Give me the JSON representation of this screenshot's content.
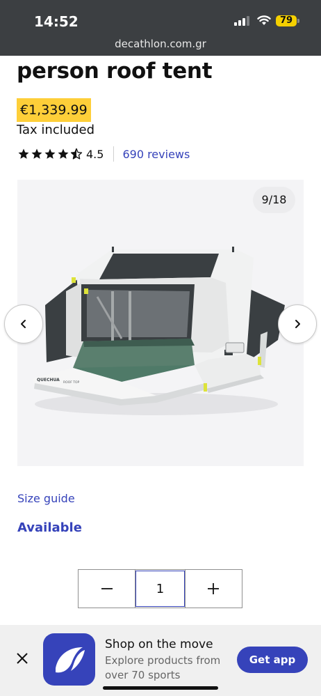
{
  "status_bar": {
    "time": "14:52",
    "battery": "79",
    "url": "decathlon.com.gr"
  },
  "product": {
    "title": "person roof tent",
    "price": "€1,339.99",
    "tax_note": "Tax included",
    "rating": {
      "stars": 4.5,
      "value": "4.5",
      "reviews_link": "690 reviews"
    }
  },
  "gallery": {
    "counter": "9/18",
    "brand_text": "QUECHUA",
    "model_text": "ROOF TOP",
    "colors": {
      "tent_body": "#f3f4f3",
      "tent_dark": "#3a3f42",
      "tent_floor": "#4f7a68",
      "accent_yellow": "#dde33a"
    }
  },
  "links": {
    "size_guide": "Size guide"
  },
  "availability": "Available",
  "quantity": {
    "value": "1"
  },
  "app_banner": {
    "title": "Shop on the move",
    "subtitle": "Explore products from over 70 sports",
    "button": "Get app"
  },
  "colors": {
    "brand_blue": "#3643ba",
    "price_highlight": "#fecf39",
    "status_bar_bg": "#3c3f42"
  },
  "icons": [
    "signal-icon",
    "wifi-icon",
    "battery-icon",
    "star-icon",
    "chevron-left-icon",
    "chevron-right-icon",
    "minus-icon",
    "plus-icon",
    "close-icon",
    "decathlon-logo-icon"
  ]
}
